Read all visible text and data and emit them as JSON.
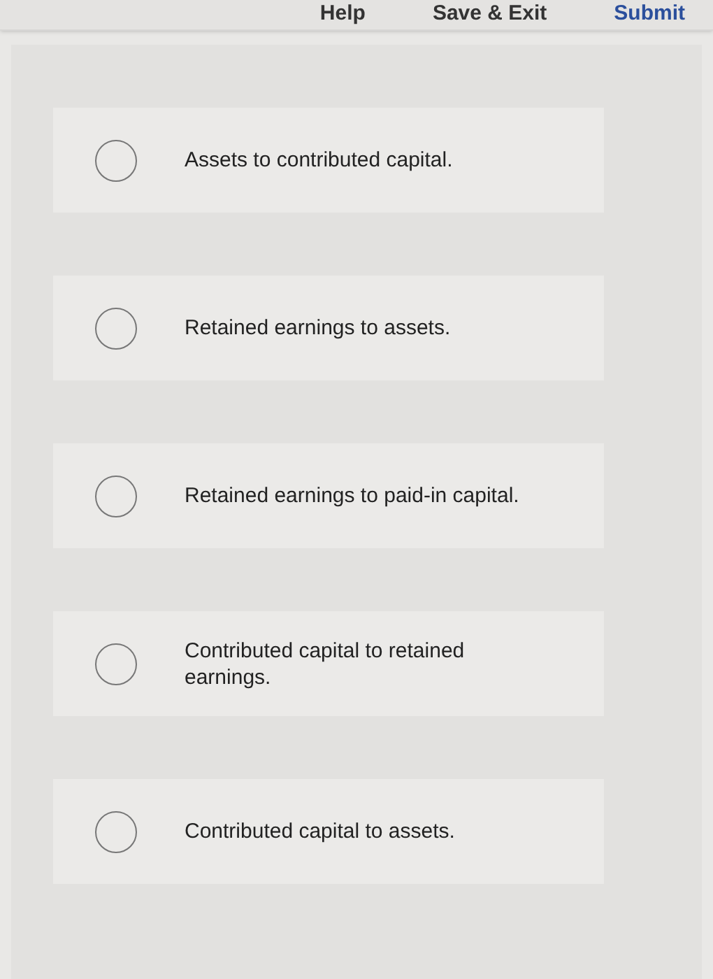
{
  "header": {
    "buttons": [
      {
        "label": "Help",
        "kind": "plain"
      },
      {
        "label": "Save & Exit",
        "kind": "plain"
      },
      {
        "label": "Submit",
        "kind": "primary"
      }
    ]
  },
  "options": [
    {
      "label": "Assets to contributed capital.",
      "selected": false
    },
    {
      "label": "Retained earnings to assets.",
      "selected": false
    },
    {
      "label": "Retained earnings to paid-in capital.",
      "selected": false
    },
    {
      "label": "Contributed capital to retained earnings.",
      "selected": false
    },
    {
      "label": "Contributed capital to assets.",
      "selected": false
    }
  ]
}
